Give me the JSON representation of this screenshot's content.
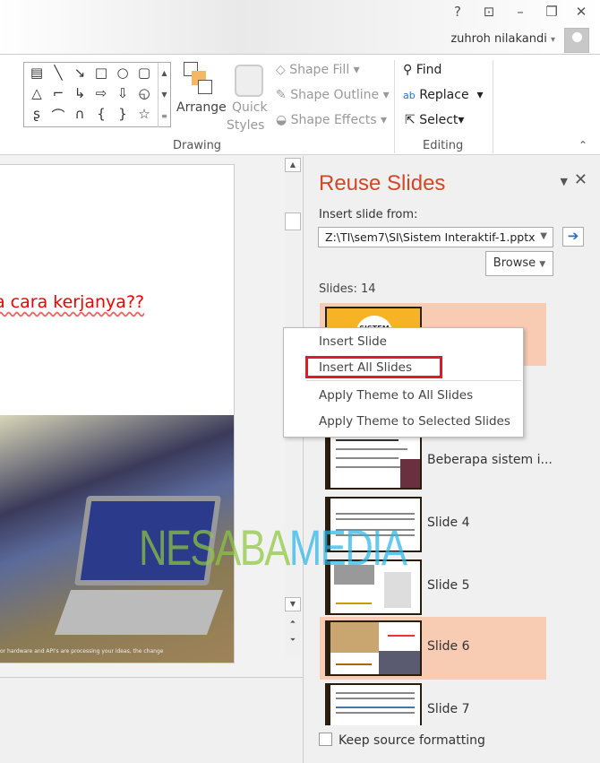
{
  "window": {
    "help": "?",
    "ribbon_display": "⊡",
    "minimize": "–",
    "restore": "❐",
    "close": "✕",
    "user": "zuhroh nilakandi",
    "user_dropdown": "▾"
  },
  "ribbon": {
    "gallery_shapes": [
      "▤",
      "╲",
      "↘",
      "□",
      "○",
      "▢",
      "△",
      "⌐",
      "↳",
      "⇨",
      "⇩",
      "◵",
      "ʂ",
      "⌒",
      "∩",
      "{",
      "}",
      "☆"
    ],
    "arrange": "Arrange",
    "quick_styles": "Quick",
    "quick_styles2": "Styles",
    "shape_fill": "Shape Fill",
    "shape_outline": "Shape Outline",
    "shape_effects": "Shape Effects",
    "drawing_group": "Drawing",
    "find": "Find",
    "replace": "Replace",
    "select": "Select",
    "editing_group": "Editing",
    "collapse": "⌃"
  },
  "slide": {
    "text": "a cara kerjanya??",
    "caption": "or hardware and API's are processing your ideas, the change"
  },
  "panel": {
    "title": "Reuse Slides",
    "insert_from_label": "Insert slide from:",
    "path": "Z:\\TI\\sem7\\SI\\Sistem Interaktif-1.pptx",
    "browse": "Browse",
    "slides_count": "Slides: 14",
    "first_thumb_text": "SISTEM",
    "slides": [
      {
        "label": "Beberapa sistem i..."
      },
      {
        "label": "Slide 4"
      },
      {
        "label": "Slide 5"
      },
      {
        "label": "Slide 6"
      },
      {
        "label": "Slide 7"
      }
    ],
    "keep_source": "Keep source formatting",
    "keep_source_checked": false
  },
  "context_menu": {
    "items": [
      "Insert Slide",
      "Insert All Slides",
      "Apply Theme to All Slides",
      "Apply Theme to Selected Slides"
    ],
    "highlighted": "Insert All Slides"
  },
  "watermark": {
    "part1": "NESABA",
    "part2": "MEDIA"
  },
  "colors": {
    "accent": "#d24726",
    "selected_row": "#f8cbb3",
    "highlight_box": "#e21b23"
  }
}
